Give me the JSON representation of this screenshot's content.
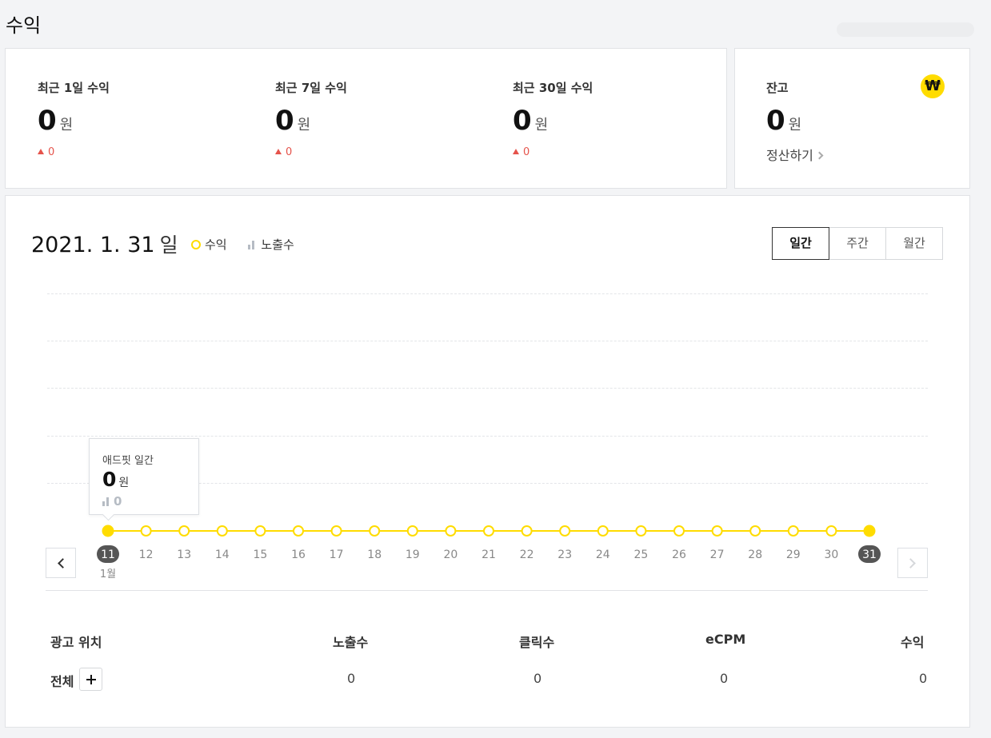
{
  "page": {
    "title": "수익"
  },
  "summary": {
    "currency_unit": "원",
    "stats": [
      {
        "label": "최근 1일 수익",
        "value": "0",
        "change": "0"
      },
      {
        "label": "최근 7일 수익",
        "value": "0",
        "change": "0"
      },
      {
        "label": "최근 30일 수익",
        "value": "0",
        "change": "0"
      }
    ]
  },
  "balance": {
    "label": "잔고",
    "value": "0",
    "unit": "원",
    "settle_label": "정산하기",
    "badge_symbol": "₩"
  },
  "chart": {
    "date": "2021. 1. 31",
    "date_unit": "일",
    "legend": {
      "revenue": "수익",
      "impressions": "노출수"
    },
    "period_tabs": [
      {
        "label": "일간",
        "active": true
      },
      {
        "label": "주간",
        "active": false
      },
      {
        "label": "월간",
        "active": false
      }
    ],
    "tooltip": {
      "title": "애드핏 일간",
      "value": "0",
      "unit": "원",
      "impressions": "0"
    },
    "month_label": "1월",
    "colors": {
      "line": "#ffdc00",
      "selected_badge": "#555555",
      "impression_icon": "#b6bcc4"
    }
  },
  "chart_data": {
    "type": "line",
    "x": [
      "11",
      "12",
      "13",
      "14",
      "15",
      "16",
      "17",
      "18",
      "19",
      "20",
      "21",
      "22",
      "23",
      "24",
      "25",
      "26",
      "27",
      "28",
      "29",
      "30",
      "31"
    ],
    "series": [
      {
        "name": "수익",
        "values": [
          0,
          0,
          0,
          0,
          0,
          0,
          0,
          0,
          0,
          0,
          0,
          0,
          0,
          0,
          0,
          0,
          0,
          0,
          0,
          0,
          0
        ]
      }
    ],
    "highlighted": [
      "11",
      "31"
    ],
    "grid": true
  },
  "table": {
    "headers": [
      "광고 위치",
      "노출수",
      "클릭수",
      "eCPM",
      "수익"
    ],
    "rows": [
      {
        "position": "전체",
        "impressions": "0",
        "clicks": "0",
        "ecpm": "0",
        "revenue": "0"
      }
    ]
  }
}
